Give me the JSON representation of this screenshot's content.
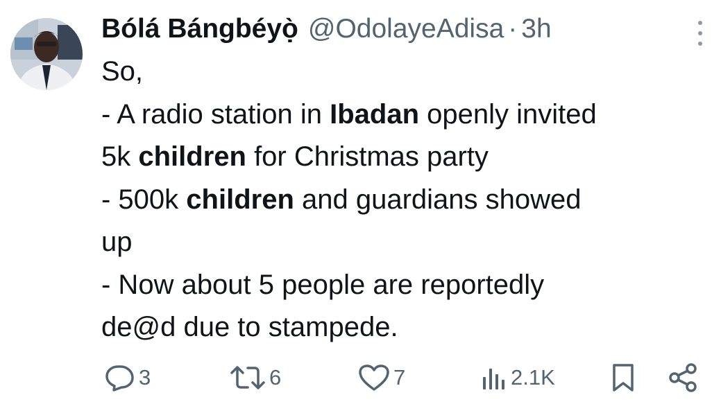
{
  "tweet": {
    "author_name": "Bólá Bángbéyọ̀",
    "handle": "@OdolayeAdisa",
    "separator": "·",
    "time": "3h",
    "body": [
      [
        {
          "t": "So,",
          "b": false
        }
      ],
      [
        {
          "t": "- A radio station in ",
          "b": false
        },
        {
          "t": "Ibadan",
          "b": true
        },
        {
          "t": " openly invited",
          "b": false
        }
      ],
      [
        {
          "t": "5k ",
          "b": false
        },
        {
          "t": "children",
          "b": true
        },
        {
          "t": " for Christmas party",
          "b": false
        }
      ],
      [
        {
          "t": "- 500k ",
          "b": false
        },
        {
          "t": "children",
          "b": true
        },
        {
          "t": " and guardians showed",
          "b": false
        }
      ],
      [
        {
          "t": "up",
          "b": false
        }
      ],
      [
        {
          "t": "- Now about 5 people are reportedly",
          "b": false
        }
      ],
      [
        {
          "t": "de@d due to stampede.",
          "b": false
        }
      ]
    ]
  },
  "actions": {
    "reply_count": "3",
    "retweet_count": "6",
    "like_count": "7",
    "views_count": "2.1K"
  },
  "icons": {
    "reply": "reply-icon",
    "retweet": "retweet-icon",
    "like": "like-icon",
    "views": "views-icon",
    "bookmark": "bookmark-icon",
    "share": "share-icon",
    "more": "more-icon"
  },
  "colors": {
    "text": "#0f1419",
    "secondary": "#536471"
  }
}
